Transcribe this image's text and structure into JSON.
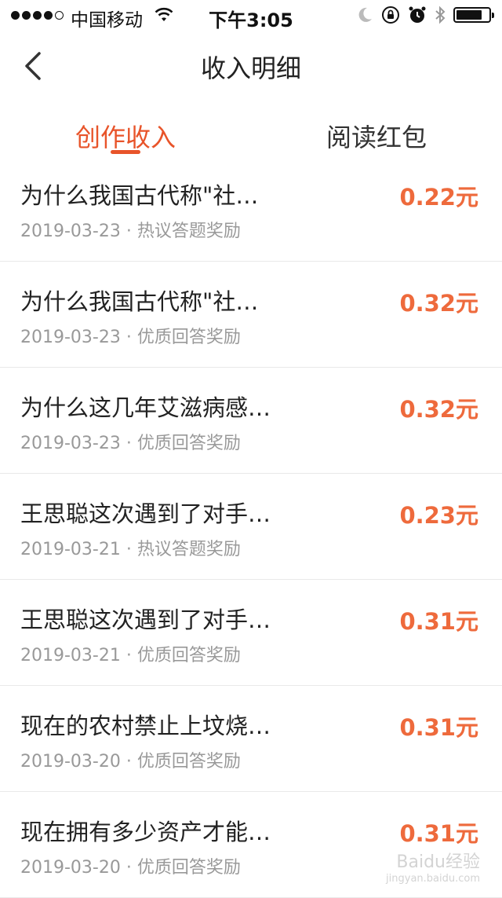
{
  "status_bar": {
    "carrier": "中国移动",
    "time": "下午3:05",
    "battery_fraction": 0.8
  },
  "nav": {
    "title": "收入明细",
    "back_icon": "chevron-left-icon"
  },
  "tabs": [
    {
      "label": "创作收入",
      "active": true
    },
    {
      "label": "阅读红包",
      "active": false
    }
  ],
  "records": [
    {
      "title": "为什么我国古代称\"社…",
      "date": "2019-03-23",
      "type": "热议答题奖励",
      "amount": "0.22元"
    },
    {
      "title": "为什么我国古代称\"社…",
      "date": "2019-03-23",
      "type": "优质回答奖励",
      "amount": "0.32元"
    },
    {
      "title": "为什么这几年艾滋病感…",
      "date": "2019-03-23",
      "type": "优质回答奖励",
      "amount": "0.32元"
    },
    {
      "title": "王思聪这次遇到了对手…",
      "date": "2019-03-21",
      "type": "热议答题奖励",
      "amount": "0.23元"
    },
    {
      "title": "王思聪这次遇到了对手…",
      "date": "2019-03-21",
      "type": "优质回答奖励",
      "amount": "0.31元"
    },
    {
      "title": "现在的农村禁止上坟烧…",
      "date": "2019-03-20",
      "type": "优质回答奖励",
      "amount": "0.31元"
    },
    {
      "title": "现在拥有多少资产才能…",
      "date": "2019-03-20",
      "type": "优质回答奖励",
      "amount": "0.31元"
    }
  ],
  "meta_separator": " · ",
  "watermark": {
    "text": "Baidu经验",
    "sub": "jingyan.baidu.com"
  },
  "colors": {
    "accent": "#e8542a",
    "amount": "#ee6a3c",
    "meta": "#999999"
  }
}
